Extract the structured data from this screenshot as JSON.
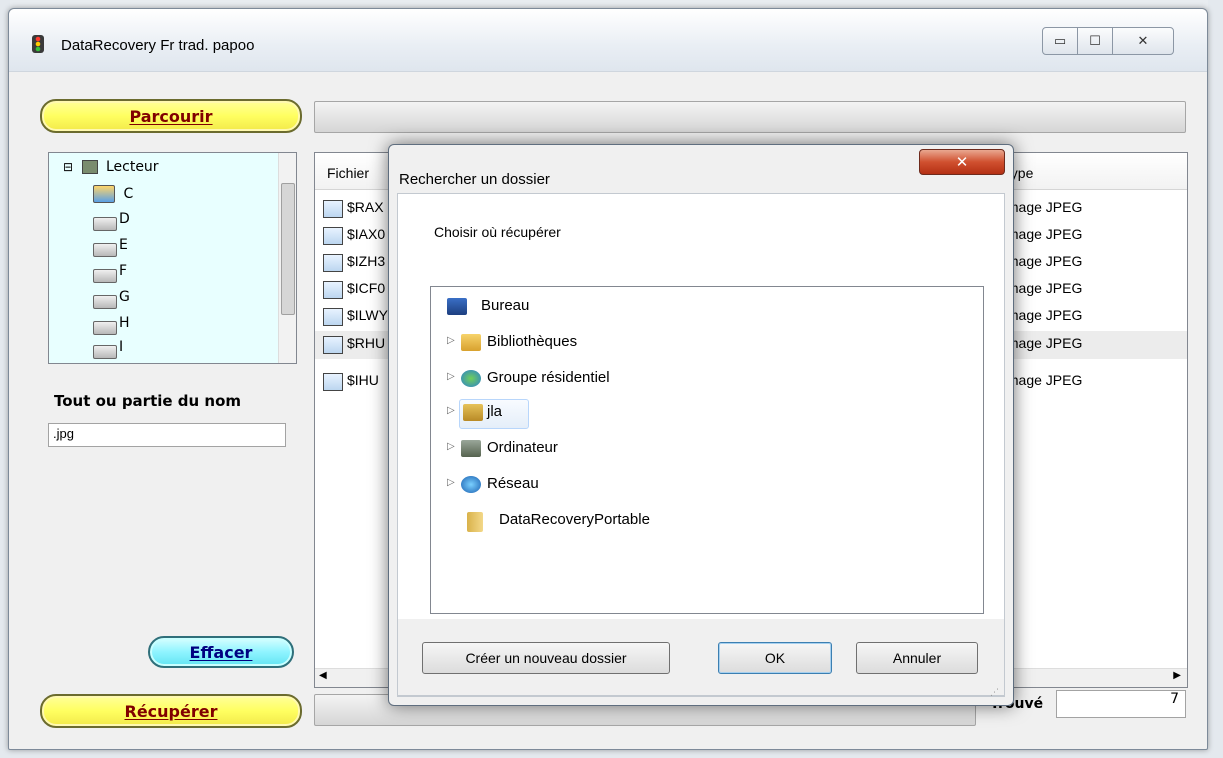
{
  "window": {
    "title": "DataRecovery Fr trad. papoo",
    "minimize_glyph": "▭",
    "maximize_glyph": "☐",
    "close_glyph": "✕"
  },
  "toolbar": {
    "browse_label": "Parcourir",
    "recover_label": "Récupérer",
    "clear_label": "Effacer"
  },
  "drive_tree": {
    "root": "Lecteur",
    "root_glyph": "⊟",
    "drives": [
      "C",
      "D",
      "E",
      "F",
      "G",
      "H",
      "I"
    ]
  },
  "name_filter": {
    "label": "Tout ou partie du nom",
    "value": ".jpg"
  },
  "file_list": {
    "columns": {
      "file": "Fichier",
      "type": "Type"
    },
    "rows": [
      {
        "name": "$RAX",
        "type": "Image JPEG"
      },
      {
        "name": "$IAX0",
        "type": "Image JPEG"
      },
      {
        "name": "$IZH3",
        "type": "Image JPEG"
      },
      {
        "name": "$ICF0",
        "type": "Image JPEG"
      },
      {
        "name": "$ILWY",
        "type": "Image JPEG"
      },
      {
        "name": "$RHU",
        "type": "Image JPEG"
      },
      {
        "name": "$IHU",
        "type": "Image JPEG"
      }
    ],
    "found_label": "Trouvé",
    "found_count": "7"
  },
  "dialog": {
    "title": "Rechercher un dossier",
    "close_glyph": "✕",
    "prompt": "Choisir où récupérer",
    "expander_glyph": "▷",
    "folders": [
      {
        "label": "Bureau"
      },
      {
        "label": "Bibliothèques"
      },
      {
        "label": "Groupe résidentiel"
      },
      {
        "label": "jla"
      },
      {
        "label": "Ordinateur"
      },
      {
        "label": "Réseau"
      },
      {
        "label": "DataRecoveryPortable"
      }
    ],
    "new_folder_label": "Créer un nouveau dossier",
    "ok_label": "OK",
    "cancel_label": "Annuler"
  },
  "colors": {
    "pill_yellow": "#ffff60",
    "pill_cyan": "#8ff4ff",
    "pill_text": "#800000",
    "tree_bg": "#e8ffff",
    "dialog_close": "#d0502f"
  }
}
